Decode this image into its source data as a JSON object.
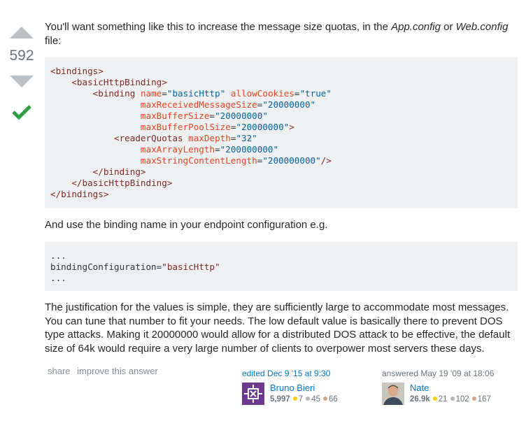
{
  "vote": {
    "count": "592"
  },
  "colors": {
    "accept": "#2f9e45",
    "link": "#0077cc",
    "code_bg": "#eff0f1"
  },
  "post": {
    "p1_pre": "You'll want something like this to increase the message size quotas, in the ",
    "p1_em1": "App.config",
    "p1_mid": " or ",
    "p1_em2": "Web.config",
    "p1_post": " file:",
    "p2": "And use the binding name in your endpoint configuration e.g.",
    "p3": "The justification for the values is simple, they are sufficiently large to accommodate most messages. You can tune that number to fit your needs. The low default value is basically there to prevent DOS type attacks. Making it 20000000 would allow for a distributed DOS attack to be effective, the default size of 64k would require a very large number of clients to overpower most servers these days."
  },
  "code1": {
    "l1": "<bindings>",
    "l2": "<basicHttpBinding>",
    "l3_tag": "<binding",
    "name_attr": "name",
    "name_val": "\"basicHttp\"",
    "cookies_attr": "allowCookies",
    "cookies_val": "\"true\"",
    "recv_attr": "maxReceivedMessageSize",
    "recv_val": "\"20000000\"",
    "buf_attr": "maxBufferSize",
    "buf_val": "\"20000000\"",
    "pool_attr": "maxBufferPoolSize",
    "pool_val": "\"20000000\"",
    "l3_close": ">",
    "rq_tag": "<readerQuotas",
    "depth_attr": "maxDepth",
    "depth_val": "\"32\"",
    "arr_attr": "maxArrayLength",
    "arr_val": "\"200000000\"",
    "str_attr": "maxStringContentLength",
    "str_val": "\"200000000\"",
    "rq_close": "/>",
    "end_binding": "</binding>",
    "end_basic": "</basicHttpBinding>",
    "end_bindings": "</bindings>"
  },
  "code2": {
    "dots1": "...",
    "attr": "bindingConfiguration",
    "eq": "=",
    "val": "\"basicHttp\"",
    "dots2": "..."
  },
  "menu": {
    "share": "share",
    "improve": "improve this answer"
  },
  "edited": {
    "action": "edited",
    "date": "Dec 9 '15 at 9:30",
    "user": "Bruno Bieri",
    "rep": "5,997",
    "gold": "7",
    "silver": "45",
    "bronze": "66"
  },
  "answered": {
    "action": "answered",
    "date": "May 19 '09 at 18:06",
    "user": "Nate",
    "rep": "26.9k",
    "gold": "21",
    "silver": "102",
    "bronze": "167"
  },
  "icons": {
    "vote_up": "vote-up-arrow-icon",
    "vote_down": "vote-down-arrow-icon",
    "accepted": "checkmark-icon"
  }
}
